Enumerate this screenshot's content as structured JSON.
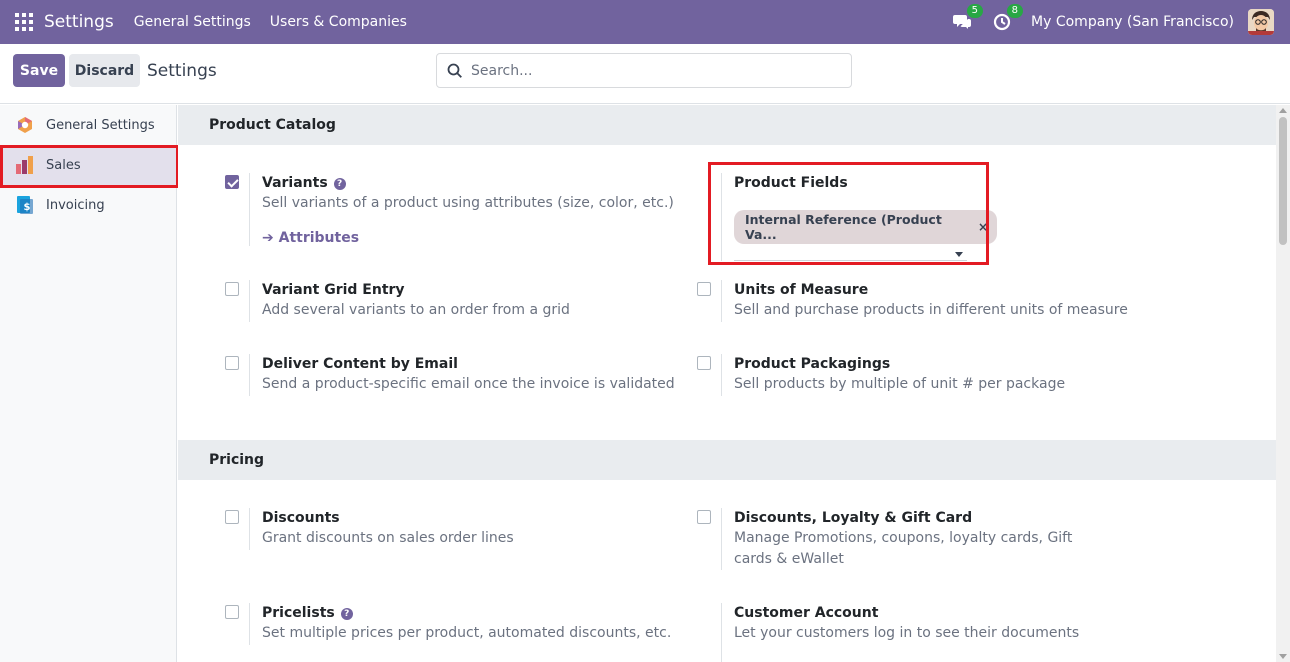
{
  "navbar": {
    "brand": "Settings",
    "menu": [
      "General Settings",
      "Users & Companies"
    ],
    "messages_count": "5",
    "activities_count": "8",
    "company": "My Company (San Francisco)",
    "icons": [
      "apps-grid-icon",
      "chat-icon",
      "clock-icon",
      "avatar"
    ]
  },
  "control": {
    "save_label": "Save",
    "discard_label": "Discard",
    "title": "Settings",
    "search_placeholder": "Search..."
  },
  "sidebar": {
    "items": [
      {
        "label": "General Settings",
        "icon": "odoo-logo-icon",
        "active": false
      },
      {
        "label": "Sales",
        "icon": "sales-chart-icon",
        "active": true
      },
      {
        "label": "Invoicing",
        "icon": "invoice-icon",
        "active": false
      }
    ]
  },
  "sections": {
    "product_catalog": {
      "title": "Product Catalog",
      "variants": {
        "title": "Variants",
        "desc": "Sell variants of a product using attributes (size, color, etc.)",
        "checked": true,
        "link": "Attributes"
      },
      "product_fields": {
        "title": "Product Fields",
        "tag": "Internal Reference (Product Va..."
      },
      "variant_grid": {
        "title": "Variant Grid Entry",
        "desc": "Add several variants to an order from a grid",
        "checked": false
      },
      "uom": {
        "title": "Units of Measure",
        "desc": "Sell and purchase products in different units of measure",
        "checked": false
      },
      "deliver_email": {
        "title": "Deliver Content by Email",
        "desc": "Send a product-specific email once the invoice is validated",
        "checked": false
      },
      "packagings": {
        "title": "Product Packagings",
        "desc": "Sell products by multiple of unit # per package",
        "checked": false
      }
    },
    "pricing": {
      "title": "Pricing",
      "discounts": {
        "title": "Discounts",
        "desc": "Grant discounts on sales order lines",
        "checked": false
      },
      "loyalty": {
        "title": "Discounts, Loyalty & Gift Card",
        "desc": "Manage Promotions, coupons, loyalty cards, Gift cards & eWallet",
        "checked": false
      },
      "pricelists": {
        "title": "Pricelists",
        "desc": "Set multiple prices per product, automated discounts, etc.",
        "checked": false
      },
      "customer_account": {
        "title": "Customer Account",
        "desc": "Let your customers log in to see their documents"
      }
    }
  },
  "colors": {
    "brand": "#71639e",
    "highlight": "#e31b23",
    "badge": "#28a745"
  }
}
